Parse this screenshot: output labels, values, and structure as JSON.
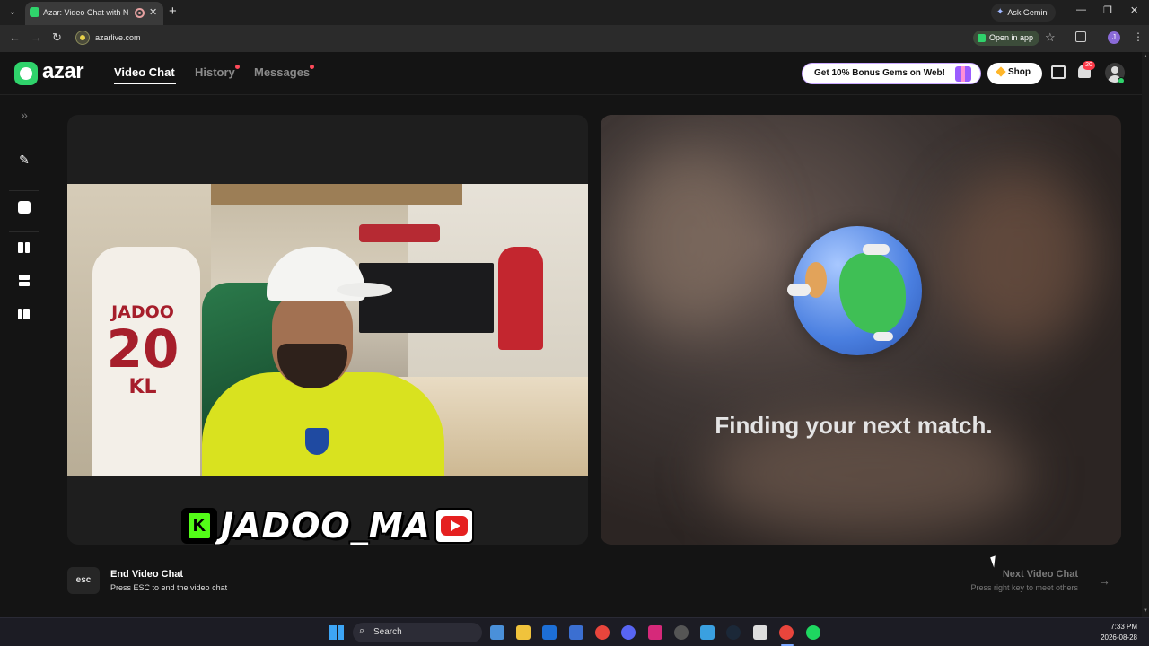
{
  "browser": {
    "tab_title": "Azar: Video Chat with New",
    "new_tab_label": "+",
    "gemini_label": "Ask Gemini",
    "url": "azarlive.com",
    "open_in_app_label": "Open in app",
    "profile_initial": "J"
  },
  "header": {
    "logo_text": "azar",
    "nav": [
      {
        "label": "Video Chat",
        "active": true,
        "has_dot": false
      },
      {
        "label": "History",
        "active": false,
        "has_dot": true
      },
      {
        "label": "Messages",
        "active": false,
        "has_dot": true
      }
    ],
    "promo_label": "Get 10% Bonus Gems on Web!",
    "shop_label": "Shop",
    "notification_count": "20"
  },
  "sidebar": {
    "icons": [
      "expand-icon",
      "magic-wand-icon",
      "filter-icon",
      "layout-side-by-side-icon",
      "layout-stacked-icon",
      "layout-grid-icon"
    ]
  },
  "left_panel": {
    "jersey_name": "JADOO",
    "jersey_number": "20",
    "jersey_letters": "KL",
    "streamer_name": "JADOO_MA"
  },
  "right_panel": {
    "status_text": "Finding your next match."
  },
  "controls": {
    "esc_key": "esc",
    "end_title": "End Video Chat",
    "end_hint": "Press ESC to end the video chat",
    "next_title": "Next Video Chat",
    "next_hint": "Press right key to meet others",
    "next_arrow": "→"
  },
  "taskbar": {
    "search_label": "Search",
    "time": "7:33 PM",
    "date": "2026-08-28"
  },
  "colors": {
    "brand_green": "#2fd36b",
    "notification_red": "#ff3b4a",
    "kick_green": "#53fc18"
  }
}
